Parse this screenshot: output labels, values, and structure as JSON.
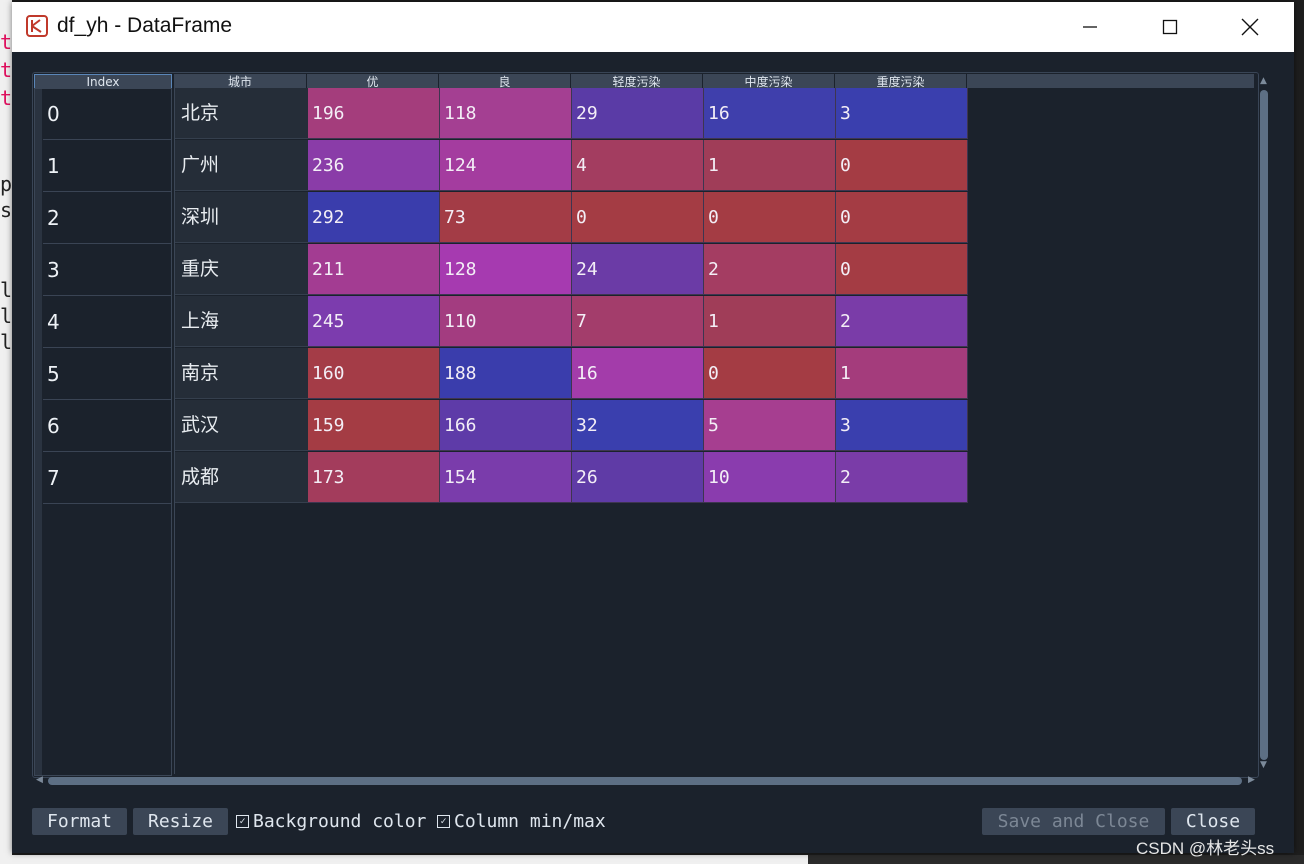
{
  "window": {
    "title": "df_yh - DataFrame",
    "minimize_icon": "minimize-icon",
    "maximize_icon": "maximize-icon",
    "close_icon": "close-icon"
  },
  "table": {
    "index_header": "Index",
    "columns": [
      "城市",
      "优",
      "良",
      "轻度污染",
      "中度污染",
      "重度污染"
    ],
    "rows": [
      {
        "index": "0",
        "city": "北京",
        "values": [
          "196",
          "118",
          "29",
          "16",
          "3"
        ]
      },
      {
        "index": "1",
        "city": "广州",
        "values": [
          "236",
          "124",
          "4",
          "1",
          "0"
        ]
      },
      {
        "index": "2",
        "city": "深圳",
        "values": [
          "292",
          "73",
          "0",
          "0",
          "0"
        ]
      },
      {
        "index": "3",
        "city": "重庆",
        "values": [
          "211",
          "128",
          "24",
          "2",
          "0"
        ]
      },
      {
        "index": "4",
        "city": "上海",
        "values": [
          "245",
          "110",
          "7",
          "1",
          "2"
        ]
      },
      {
        "index": "5",
        "city": "南京",
        "values": [
          "160",
          "188",
          "16",
          "0",
          "1"
        ]
      },
      {
        "index": "6",
        "city": "武汉",
        "values": [
          "159",
          "166",
          "32",
          "5",
          "3"
        ]
      },
      {
        "index": "7",
        "city": "成都",
        "values": [
          "173",
          "154",
          "26",
          "10",
          "2"
        ]
      }
    ],
    "cell_colors": [
      [
        "#a43d7c",
        "#a43f92",
        "#5a3ba6",
        "#3f3fac",
        "#3a3fae"
      ],
      [
        "#8a3ca8",
        "#a43c9f",
        "#a33d60",
        "#a03d58",
        "#a43c44"
      ],
      [
        "#3a3dac",
        "#a33c46",
        "#a43c44",
        "#a43c44",
        "#a43c44"
      ],
      [
        "#a33c92",
        "#a63ab0",
        "#6b3ba6",
        "#a43d62",
        "#a43c44"
      ],
      [
        "#7c3cae",
        "#a33c80",
        "#a33d6b",
        "#a03d58",
        "#7a3ca8"
      ],
      [
        "#a43c47",
        "#3a3dac",
        "#a33caa",
        "#a43c44",
        "#a43c7c"
      ],
      [
        "#a43c44",
        "#5e3ba8",
        "#3a3fae",
        "#a63e90",
        "#3a3fae"
      ],
      [
        "#a33c5c",
        "#7a3cab",
        "#5f3ba6",
        "#8a3cae",
        "#7a3ca8"
      ]
    ]
  },
  "footer": {
    "format_label": "Format",
    "resize_label": "Resize",
    "background_color_label": "Background color",
    "column_minmax_label": "Column min/max",
    "save_close_label": "Save and Close",
    "close_label": "Close"
  },
  "watermark": "CSDN @林老头ss"
}
